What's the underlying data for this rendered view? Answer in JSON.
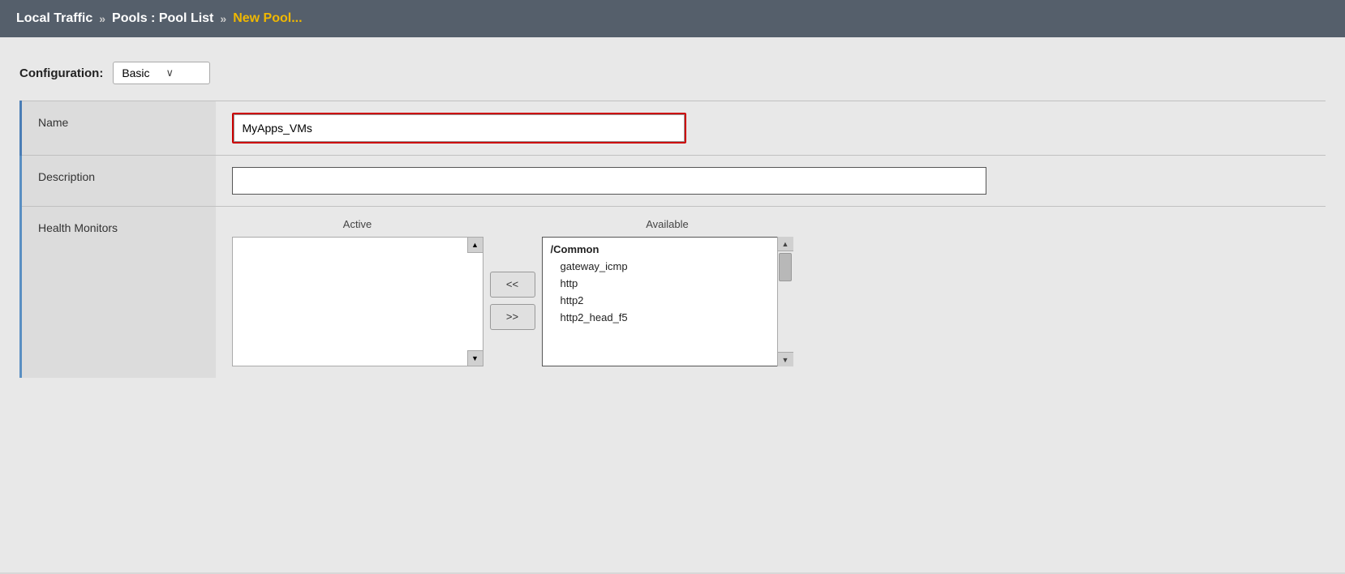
{
  "header": {
    "part1": "Local Traffic",
    "chevron1": "»",
    "part2": "Pools : Pool List",
    "chevron2": "»",
    "part3": "New Pool..."
  },
  "configuration": {
    "label": "Configuration:",
    "select_value": "Basic",
    "chevron": "∨"
  },
  "form": {
    "name_label": "Name",
    "name_value": "MyApps_VMs",
    "name_placeholder": "",
    "description_label": "Description",
    "description_value": "",
    "description_placeholder": "",
    "health_monitors_label": "Health Monitors",
    "active_column_label": "Active",
    "available_column_label": "Available",
    "transfer_left": "<<",
    "transfer_right": ">>",
    "available_items": [
      {
        "text": "/Common",
        "bold": true
      },
      {
        "text": "gateway_icmp",
        "bold": false
      },
      {
        "text": "http",
        "bold": false
      },
      {
        "text": "http2",
        "bold": false
      },
      {
        "text": "http2_head_f5",
        "bold": false
      }
    ]
  }
}
